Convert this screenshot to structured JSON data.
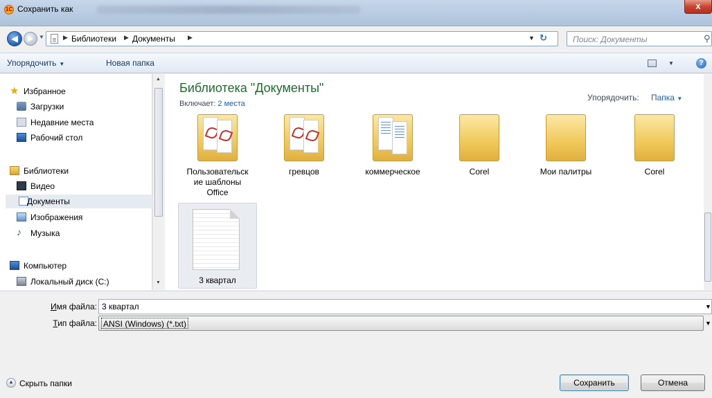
{
  "window": {
    "title": "Сохранить как",
    "close_label": "x"
  },
  "navigation": {
    "breadcrumbs": [
      "Библиотеки",
      "Документы"
    ],
    "search_placeholder": "Поиск: Документы"
  },
  "toolbar": {
    "organize_label": "Упорядочить",
    "new_folder_label": "Новая папка"
  },
  "sidebar": {
    "favorites": {
      "header": "Избранное",
      "items": [
        "Загрузки",
        "Недавние места",
        "Рабочий стол"
      ]
    },
    "libraries": {
      "header": "Библиотеки",
      "items": [
        "Видео",
        "Документы",
        "Изображения",
        "Музыка"
      ],
      "selected": "Документы"
    },
    "computer": {
      "header": "Компьютер",
      "items": [
        "Локальный диск (C:)"
      ]
    }
  },
  "library": {
    "title": "Библиотека \"Документы\"",
    "includes_label": "Включает:",
    "includes_link": "2 места",
    "arrange_label": "Упорядочить:",
    "arrange_value": "Папка"
  },
  "files": [
    {
      "name": "Пользовательские шаблоны Office",
      "line1": "Пользовательск",
      "line2": "ие шаблоны",
      "line3": "Office",
      "type": "folder-pdf"
    },
    {
      "name": "гревцов",
      "type": "folder-pdf"
    },
    {
      "name": "коммерческое",
      "type": "folder-doc"
    },
    {
      "name": "Corel",
      "type": "folder"
    },
    {
      "name": "Мои палитры",
      "type": "folder"
    },
    {
      "name": "Corel",
      "type": "folder"
    },
    {
      "name": "3 квартал",
      "type": "txt",
      "selected": true
    }
  ],
  "form": {
    "filename_label_u": "И",
    "filename_label_rest": "мя файла:",
    "filename_value": "3 квартал",
    "filetype_label_u": "Т",
    "filetype_label_rest": "ип файла:",
    "filetype_value": "ANSI (Windows) (*.txt)"
  },
  "footer": {
    "hide_folders_label": "Скрыть папки",
    "save_label": "Сохранить",
    "cancel_label": "Отмена"
  },
  "colors": {
    "library_title": "#1e6d2b",
    "link": "#1a5fb4",
    "toolbar_text": "#1b3a66"
  }
}
